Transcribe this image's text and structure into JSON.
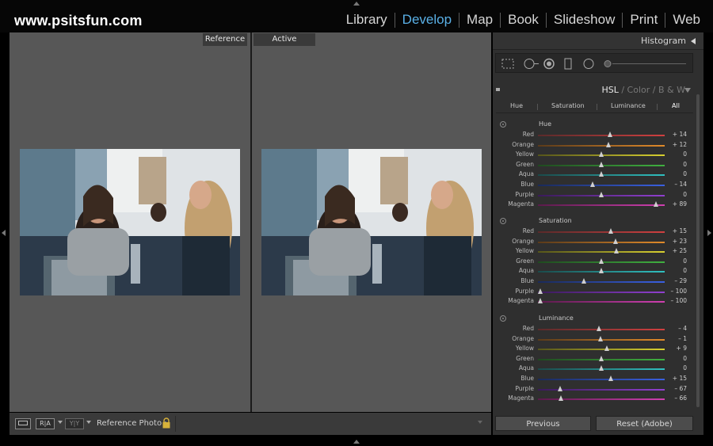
{
  "site": {
    "title": "www.psitsfun.com"
  },
  "modules": [
    "Library",
    "Develop",
    "Map",
    "Book",
    "Slideshow",
    "Print",
    "Web"
  ],
  "active_module": "Develop",
  "compare": {
    "left_label": "Reference",
    "right_label": "Active"
  },
  "toolbar": {
    "ra_label": "R|A",
    "yy_label": "Y|Y",
    "reference_photo_label": "Reference Photo :"
  },
  "panel": {
    "histogram_title": "Histogram",
    "hsl_tabs": {
      "hsl": "HSL",
      "sep": "/",
      "color": "Color",
      "bw": "B & W"
    },
    "subtabs": [
      "Hue",
      "Saturation",
      "Luminance",
      "All"
    ],
    "sections": [
      {
        "title": "Hue",
        "sliders": [
          {
            "label": "Red",
            "value": "+ 14",
            "position": 14
          },
          {
            "label": "Orange",
            "value": "+ 12",
            "position": 12
          },
          {
            "label": "Yellow",
            "value": "0",
            "position": 0
          },
          {
            "label": "Green",
            "value": "0",
            "position": 0
          },
          {
            "label": "Aqua",
            "value": "0",
            "position": 0
          },
          {
            "label": "Blue",
            "value": "– 14",
            "position": -14
          },
          {
            "label": "Purple",
            "value": "0",
            "position": 0
          },
          {
            "label": "Magenta",
            "value": "+ 89",
            "position": 89
          }
        ]
      },
      {
        "title": "Saturation",
        "sliders": [
          {
            "label": "Red",
            "value": "+ 15",
            "position": 15
          },
          {
            "label": "Orange",
            "value": "+ 23",
            "position": 23
          },
          {
            "label": "Yellow",
            "value": "+ 25",
            "position": 25
          },
          {
            "label": "Green",
            "value": "0",
            "position": 0
          },
          {
            "label": "Aqua",
            "value": "0",
            "position": 0
          },
          {
            "label": "Blue",
            "value": "– 29",
            "position": -29
          },
          {
            "label": "Purple",
            "value": "– 100",
            "position": -100
          },
          {
            "label": "Magenta",
            "value": "– 100",
            "position": -100
          }
        ]
      },
      {
        "title": "Luminance",
        "sliders": [
          {
            "label": "Red",
            "value": "– 4",
            "position": -4
          },
          {
            "label": "Orange",
            "value": "– 1",
            "position": -1
          },
          {
            "label": "Yellow",
            "value": "+ 9",
            "position": 9
          },
          {
            "label": "Green",
            "value": "0",
            "position": 0
          },
          {
            "label": "Aqua",
            "value": "0",
            "position": 0
          },
          {
            "label": "Blue",
            "value": "+ 15",
            "position": 15
          },
          {
            "label": "Purple",
            "value": "– 67",
            "position": -67
          },
          {
            "label": "Magenta",
            "value": "– 66",
            "position": -66
          }
        ]
      }
    ],
    "previous_label": "Previous",
    "reset_label": "Reset (Adobe)"
  },
  "colors": {
    "accent": "#5ab0e6",
    "tracks": {
      "Red": [
        "#5a2a2a",
        "#d04040"
      ],
      "Orange": [
        "#5a3a1a",
        "#e08a2a"
      ],
      "Yellow": [
        "#55551a",
        "#d8d030"
      ],
      "Green": [
        "#1f4a1f",
        "#40b040"
      ],
      "Aqua": [
        "#1a4a4a",
        "#30c0c0"
      ],
      "Blue": [
        "#1a2a5a",
        "#3a60e0"
      ],
      "Purple": [
        "#3a1a5a",
        "#9040d0"
      ],
      "Magenta": [
        "#5a1a4a",
        "#d040b0"
      ]
    }
  }
}
